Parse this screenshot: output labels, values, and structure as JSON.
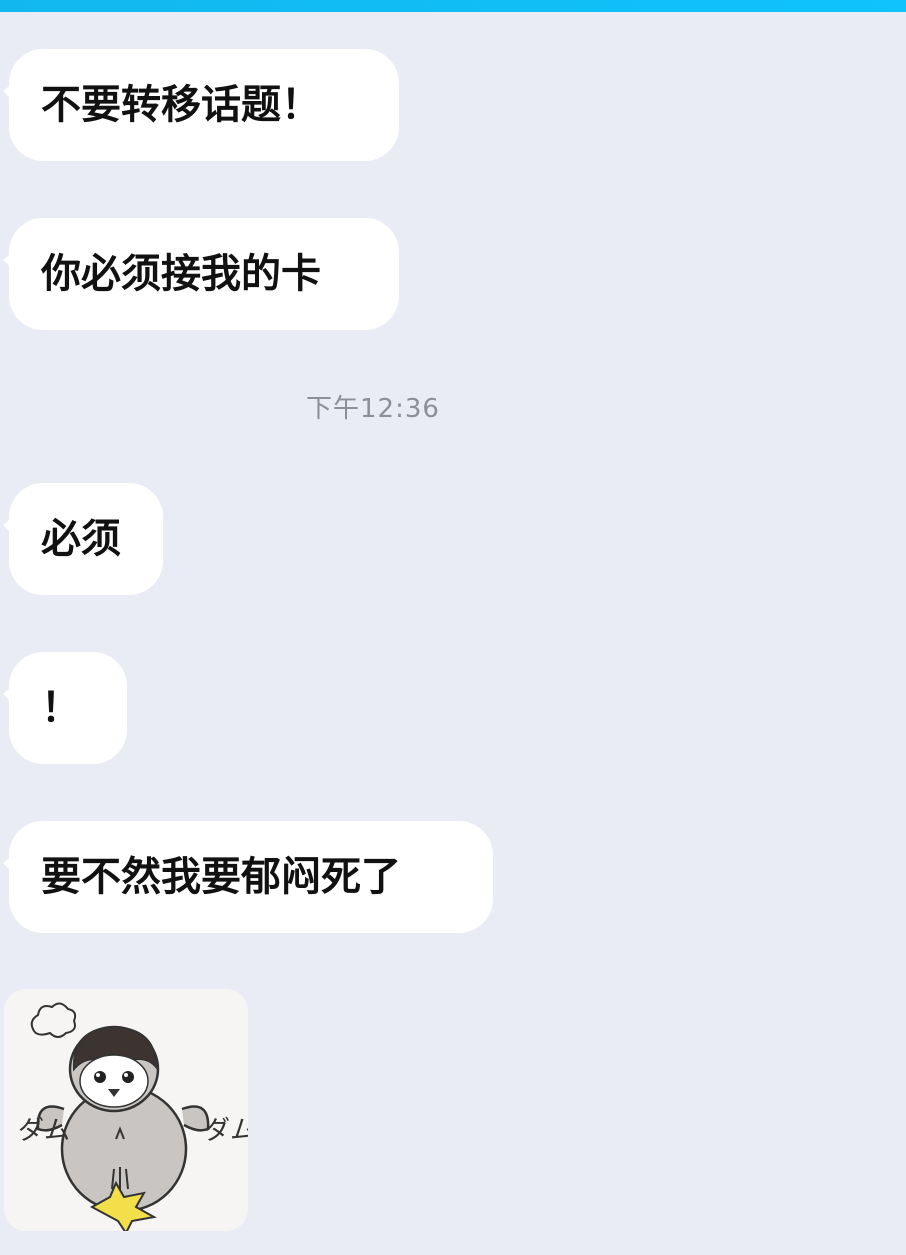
{
  "colors": {
    "background": "#e9ecf5",
    "bubble": "#ffffff",
    "accent_bar": "#10c3fb",
    "timestamp": "#8d8f96"
  },
  "messages": [
    {
      "text": "不要转移话题！"
    },
    {
      "text": "你必须接我的卡"
    },
    {
      "text": "必须"
    },
    {
      "text": "！"
    },
    {
      "text": "要不然我要郁闷死了"
    }
  ],
  "timestamp": "下午12:36",
  "sticker": {
    "icon": "penguin-sticker-icon",
    "caption_left": "ダム",
    "caption_right": "ダム"
  }
}
